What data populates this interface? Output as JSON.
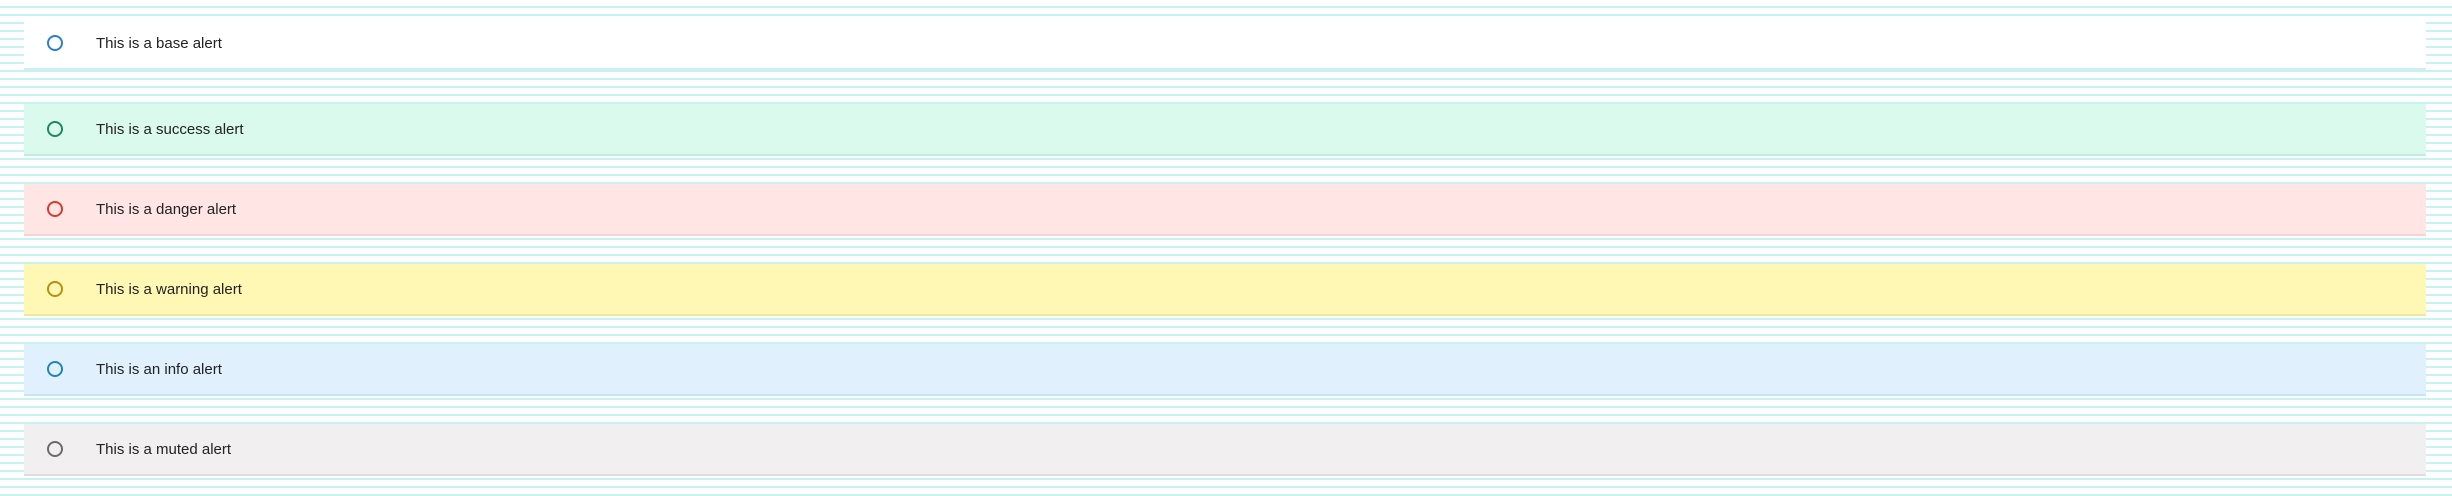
{
  "alerts": [
    {
      "variant": "base",
      "text": "This is a base alert",
      "icon": "circle-outline-icon",
      "icon_color": "#2a7fd4",
      "background": "#ffffff"
    },
    {
      "variant": "success",
      "text": "This is a success alert",
      "icon": "circle-outline-icon",
      "icon_color": "#1d8a5c",
      "background": "#d9faed"
    },
    {
      "variant": "danger",
      "text": "This is a danger alert",
      "icon": "circle-outline-icon",
      "icon_color": "#d93a30",
      "background": "#ffe5e4"
    },
    {
      "variant": "warning",
      "text": "This is a warning alert",
      "icon": "circle-outline-icon",
      "icon_color": "#b8900c",
      "background": "#fff8b4"
    },
    {
      "variant": "info",
      "text": "This is an info alert",
      "icon": "circle-outline-icon",
      "icon_color": "#1f85b8",
      "background": "#e0f1fd"
    },
    {
      "variant": "muted",
      "text": "This is a muted alert",
      "icon": "circle-outline-icon",
      "icon_color": "#6b6b6b",
      "background": "#f2eff1"
    }
  ]
}
